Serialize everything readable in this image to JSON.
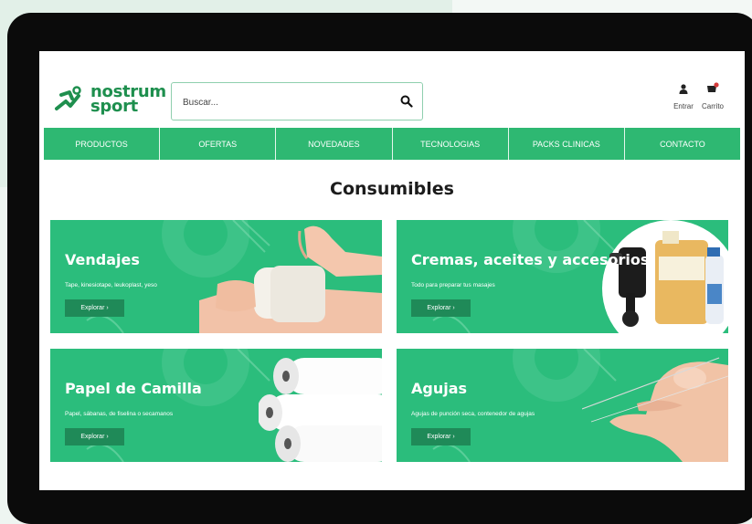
{
  "brand": {
    "line1": "nostrum",
    "line2": "sport"
  },
  "search": {
    "placeholder": "Buscar..."
  },
  "user": {
    "login_label": "Entrar",
    "cart_label": "Carrito"
  },
  "nav": [
    "PRODUCTOS",
    "OFERTAS",
    "NOVEDADES",
    "TECNOLOGIAS",
    "PACKS CLINICAS",
    "CONTACTO"
  ],
  "page": {
    "title": "Consumibles"
  },
  "categories": [
    {
      "title": "Vendajes",
      "subtitle": "Tape, kinesiotape, leukoplast, yeso",
      "button": "Explorar  ›"
    },
    {
      "title": "Cremas, aceites y accesorios",
      "subtitle": "Todo para preparar tus masajes",
      "button": "Explorar  ›"
    },
    {
      "title": "Papel de Camilla",
      "subtitle": "Papel, sábanas, de fiselina o secamanos",
      "button": "Explorar  ›"
    },
    {
      "title": "Agujas",
      "subtitle": "Agujas de punción seca, contenedor de agujas",
      "button": "Explorar  ›"
    }
  ],
  "colors": {
    "brand_green": "#2eb872",
    "dark_green": "#1f8a58",
    "card_green": "#2bbd7c"
  },
  "icons": {
    "search": "search-icon",
    "user": "user-icon",
    "cart": "cart-icon"
  }
}
